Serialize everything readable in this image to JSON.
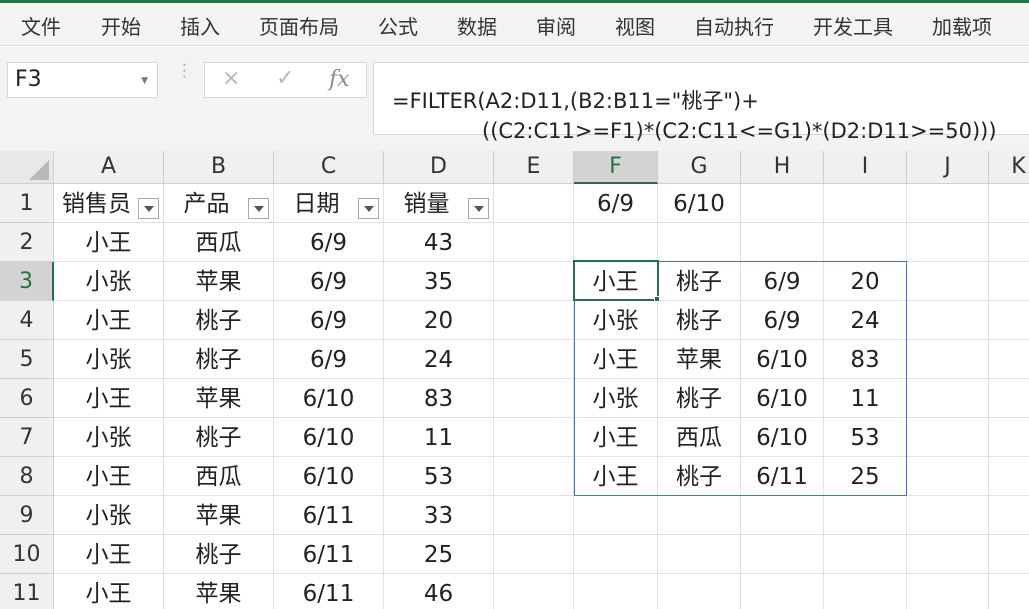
{
  "ribbon": {
    "tabs": [
      "文件",
      "开始",
      "插入",
      "页面布局",
      "公式",
      "数据",
      "审阅",
      "视图",
      "自动执行",
      "开发工具",
      "加载项"
    ]
  },
  "formula_bar": {
    "name_box": "F3",
    "cancel_icon": "×",
    "enter_icon": "✓",
    "fx_label": "fx",
    "formula_line1": "=FILTER(A2:D11,(B2:B11=\"桃子\")+",
    "formula_line2": "((C2:C11>=F1)*(C2:C11<=G1)*(D2:D11>=50)))"
  },
  "grid": {
    "columns": [
      "A",
      "B",
      "C",
      "D",
      "E",
      "F",
      "G",
      "H",
      "I",
      "J",
      "K"
    ],
    "rows": [
      "1",
      "2",
      "3",
      "4",
      "5",
      "6",
      "7",
      "8",
      "9",
      "10",
      "11"
    ],
    "selected_column": "F",
    "selected_row": "3",
    "cells": {
      "A1": "销售员",
      "B1": "产品",
      "C1": "日期",
      "D1": "销量",
      "F1": "6/9",
      "G1": "6/10",
      "A2": "小王",
      "B2": "西瓜",
      "C2": "6/9",
      "D2": "43",
      "A3": "小张",
      "B3": "苹果",
      "C3": "6/9",
      "D3": "35",
      "F3": "小王",
      "G3": "桃子",
      "H3": "6/9",
      "I3": "20",
      "A4": "小王",
      "B4": "桃子",
      "C4": "6/9",
      "D4": "20",
      "F4": "小张",
      "G4": "桃子",
      "H4": "6/9",
      "I4": "24",
      "A5": "小张",
      "B5": "桃子",
      "C5": "6/9",
      "D5": "24",
      "F5": "小王",
      "G5": "苹果",
      "H5": "6/10",
      "I5": "83",
      "A6": "小王",
      "B6": "苹果",
      "C6": "6/10",
      "D6": "83",
      "F6": "小张",
      "G6": "桃子",
      "H6": "6/10",
      "I6": "11",
      "A7": "小张",
      "B7": "桃子",
      "C7": "6/10",
      "D7": "11",
      "F7": "小王",
      "G7": "西瓜",
      "H7": "6/10",
      "I7": "53",
      "A8": "小王",
      "B8": "西瓜",
      "C8": "6/10",
      "D8": "53",
      "F8": "小王",
      "G8": "桃子",
      "H8": "6/11",
      "I8": "25",
      "A9": "小张",
      "B9": "苹果",
      "C9": "6/11",
      "D9": "33",
      "A10": "小王",
      "B10": "桃子",
      "C10": "6/11",
      "D10": "25",
      "A11": "小王",
      "B11": "苹果",
      "C11": "6/11",
      "D11": "46"
    },
    "filter_header_cells": [
      "A1",
      "B1",
      "C1",
      "D1"
    ]
  }
}
